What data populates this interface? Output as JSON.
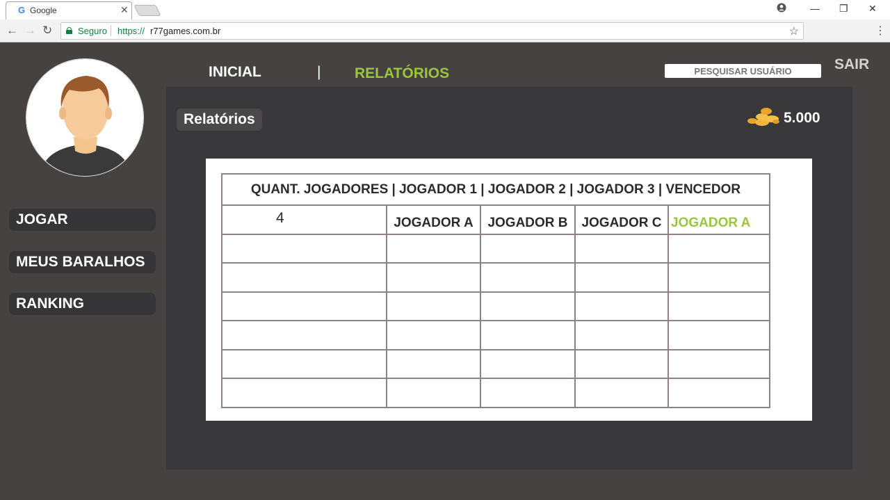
{
  "browser": {
    "tab_title": "Google",
    "tab_favicon": "G",
    "secure_label": "Seguro",
    "url_scheme": "https://",
    "url_host": "r77games.com.br"
  },
  "nav": {
    "home": "INICIAL",
    "separator": "|",
    "reports": "RELATÓRIOS",
    "search_placeholder": "PESQUISAR USUÁRIO",
    "logout": "SAIR"
  },
  "sidebar": {
    "items": [
      {
        "label": "JOGAR"
      },
      {
        "label": "MEUS BARALHOS"
      },
      {
        "label": "RANKING"
      }
    ]
  },
  "main": {
    "title": "Relatórios",
    "coins": "5.000"
  },
  "report_table": {
    "header": "QUANT. JOGADORES | JOGADOR 1 | JOGADOR 2 | JOGADOR 3 | VENCEDOR",
    "rows": [
      {
        "count": "4",
        "player1": "JOGADOR A",
        "player2": "JOGADOR B",
        "player3": "JOGADOR C",
        "winner": "JOGADOR A"
      },
      {
        "count": "",
        "player1": "",
        "player2": "",
        "player3": "",
        "winner": ""
      },
      {
        "count": "",
        "player1": "",
        "player2": "",
        "player3": "",
        "winner": ""
      },
      {
        "count": "",
        "player1": "",
        "player2": "",
        "player3": "",
        "winner": ""
      },
      {
        "count": "",
        "player1": "",
        "player2": "",
        "player3": "",
        "winner": ""
      },
      {
        "count": "",
        "player1": "",
        "player2": "",
        "player3": "",
        "winner": ""
      },
      {
        "count": "",
        "player1": "",
        "player2": "",
        "player3": "",
        "winner": ""
      }
    ]
  },
  "colors": {
    "accent": "#9bc53d",
    "page_bg": "#454241",
    "panel_bg": "#38373a"
  },
  "icons": [
    "user-avatar-icon",
    "coins-icon",
    "lock-icon",
    "star-icon",
    "back-arrow-icon",
    "forward-arrow-icon",
    "reload-icon",
    "account-icon"
  ]
}
